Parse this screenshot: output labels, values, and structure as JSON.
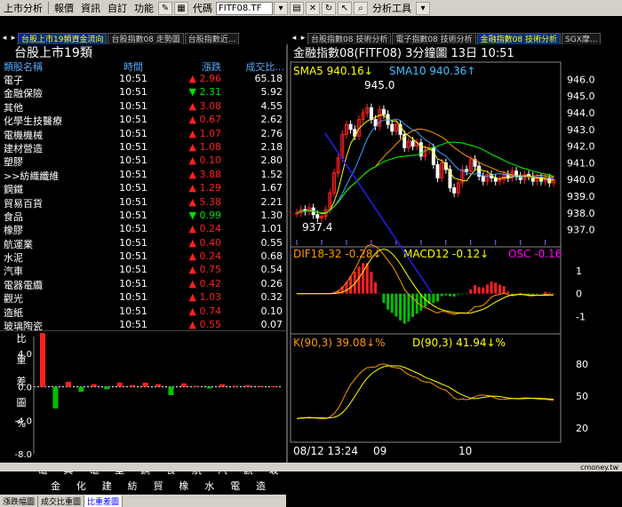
{
  "toolbar": {
    "menu": [
      "上市分析",
      "報價",
      "資訊",
      "自訂",
      "功能"
    ],
    "code_label": "代碼",
    "code_value": "FITF08.TF",
    "analysis_tools": "分析工具"
  },
  "left_tabs": [
    "台股上市19類資金流向",
    "台股指數08 走勢圖",
    "台股指數近..."
  ],
  "right_tabs": [
    "台股指數08 技術分析",
    "電子指數08 技術分析",
    "金融指數08 技術分析",
    "SGX摩..."
  ],
  "quote_table": {
    "title": "台股上市19類",
    "headers": [
      "類股名稱",
      "時間",
      "漲跌",
      "成交比..."
    ],
    "rows": [
      {
        "name": "電子",
        "time": "10:51",
        "dir": "up",
        "chg": "2.96",
        "vol": "65.18"
      },
      {
        "name": "金融保險",
        "time": "10:51",
        "dir": "dn",
        "chg": "2.31",
        "vol": "5.92"
      },
      {
        "name": "其他",
        "time": "10:51",
        "dir": "up",
        "chg": "3.08",
        "vol": "4.55"
      },
      {
        "name": "化學生技醫療",
        "time": "10:51",
        "dir": "up",
        "chg": "0.67",
        "vol": "2.62"
      },
      {
        "name": "電機機械",
        "time": "10:51",
        "dir": "up",
        "chg": "1.07",
        "vol": "2.76"
      },
      {
        "name": "建材營造",
        "time": "10:51",
        "dir": "up",
        "chg": "1.08",
        "vol": "2.18"
      },
      {
        "name": "塑膠",
        "time": "10:51",
        "dir": "up",
        "chg": "0.10",
        "vol": "2.80"
      },
      {
        "name": ">>紡織纖維",
        "time": "10:51",
        "dir": "up",
        "chg": "3.88",
        "vol": "1.52"
      },
      {
        "name": "鋼鐵",
        "time": "10:51",
        "dir": "up",
        "chg": "1.29",
        "vol": "1.67"
      },
      {
        "name": "貿易百貨",
        "time": "10:51",
        "dir": "up",
        "chg": "5.38",
        "vol": "2.21"
      },
      {
        "name": "食品",
        "time": "10:51",
        "dir": "dn",
        "chg": "0.99",
        "vol": "1.30"
      },
      {
        "name": "橡膠",
        "time": "10:51",
        "dir": "up",
        "chg": "0.24",
        "vol": "1.01"
      },
      {
        "name": "航運業",
        "time": "10:51",
        "dir": "up",
        "chg": "0.40",
        "vol": "0.55"
      },
      {
        "name": "水泥",
        "time": "10:51",
        "dir": "up",
        "chg": "0.24",
        "vol": "0.68"
      },
      {
        "name": "汽車",
        "time": "10:51",
        "dir": "up",
        "chg": "0.75",
        "vol": "0.54"
      },
      {
        "name": "電器電纜",
        "time": "10:51",
        "dir": "up",
        "chg": "0.42",
        "vol": "0.26"
      },
      {
        "name": "觀光",
        "time": "10:51",
        "dir": "up",
        "chg": "1.03",
        "vol": "0.32"
      },
      {
        "name": "造紙",
        "time": "10:51",
        "dir": "up",
        "chg": "0.74",
        "vol": "0.10"
      },
      {
        "name": "玻璃陶瓷",
        "time": "10:51",
        "dir": "up",
        "chg": "0.55",
        "vol": "0.07"
      }
    ]
  },
  "bar_panel": {
    "ylabel": [
      "比",
      "重",
      "差",
      "圖",
      "%"
    ],
    "yticks": [
      "4.0",
      "0.0",
      "-4.0",
      "-8.0"
    ],
    "xlabels_top": [
      "電",
      "其",
      "電",
      "塑",
      "鋼",
      "食",
      "航",
      "汽",
      "觀",
      "玻"
    ],
    "xlabels_bottom": [
      "金",
      "化",
      "建",
      "紡",
      "貿",
      "橡",
      "水",
      "電",
      "造"
    ],
    "colors": {
      "pos": "#ff2020",
      "neg": "#00c000"
    }
  },
  "bottom_tabs": [
    "漲跌幅圖",
    "成交比重圖",
    "比重差圖"
  ],
  "chart_data": [
    {
      "type": "bar",
      "title": "",
      "ylabel": "比重差圖%",
      "ylim": [
        -8,
        6
      ],
      "yticks": [
        4,
        0,
        -4,
        -8
      ],
      "categories": [
        "電子",
        "金融保險",
        "其他",
        "化學生技醫療",
        "電機機械",
        "建材營造",
        "塑膠",
        "紡織纖維",
        "鋼鐵",
        "貿易百貨",
        "食品",
        "橡膠",
        "航運業",
        "水泥",
        "汽車",
        "電器電纜",
        "觀光",
        "造紙",
        "玻璃陶瓷"
      ],
      "values": [
        6.4,
        -2.6,
        0.6,
        -0.6,
        0.3,
        -0.3,
        0.5,
        0.2,
        0.5,
        0.3,
        -1.0,
        0.4,
        0.1,
        -0.2,
        0.3,
        0.1,
        0.2,
        0.1,
        0.05
      ]
    },
    {
      "type": "candlestick",
      "title": "金融指數08(FITF08)  3分鐘圖  13日 10:51",
      "indicators": {
        "SMA5": "940.16",
        "SMA10": "940.36"
      },
      "annotations": {
        "high": "945.0",
        "low": "937.4"
      },
      "ylim": [
        936.5,
        946.5
      ],
      "yticks": [
        946.0,
        945.0,
        944.0,
        943.0,
        942.0,
        941.0,
        940.0,
        939.0,
        938.0,
        937.0
      ],
      "close": [
        938.0,
        938.2,
        938.1,
        938.3,
        937.9,
        937.7,
        937.8,
        938.2,
        939.2,
        940.4,
        941.3,
        942.7,
        943.3,
        943.0,
        942.6,
        943.6,
        944.0,
        944.3,
        943.6,
        943.2,
        944.2,
        943.9,
        943.3,
        942.9,
        943.3,
        942.7,
        941.9,
        942.3,
        942.0,
        942.2,
        941.4,
        941.8,
        941.9,
        940.9,
        940.1,
        941.0,
        940.6,
        939.5,
        939.2,
        939.8,
        940.6,
        940.5,
        941.2,
        940.8,
        940.2,
        939.9,
        940.3,
        940.1,
        939.9,
        940.0,
        940.3,
        940.1,
        940.5,
        940.2,
        940.0,
        940.3,
        940.2,
        939.9,
        940.1,
        939.9,
        940.1,
        939.8,
        940.0
      ]
    },
    {
      "type": "bar",
      "title": "MACD",
      "indicators": {
        "DIF18-32": "-0.28",
        "MACD12": "-0.12",
        "OSC": "-0.16"
      },
      "ylim": [
        -1.6,
        1.5
      ],
      "yticks": [
        1,
        0,
        -1
      ]
    },
    {
      "type": "line",
      "title": "KD",
      "indicators": {
        "K(90,3)": "39.08",
        "D(90,3)": "41.94"
      },
      "ylim": [
        10,
        95
      ],
      "yticks": [
        80,
        50,
        20
      ],
      "xlabels": [
        "08/12 13:24",
        "09",
        "10"
      ]
    }
  ],
  "statusbar": {
    "brand": "cmoney.tw"
  }
}
